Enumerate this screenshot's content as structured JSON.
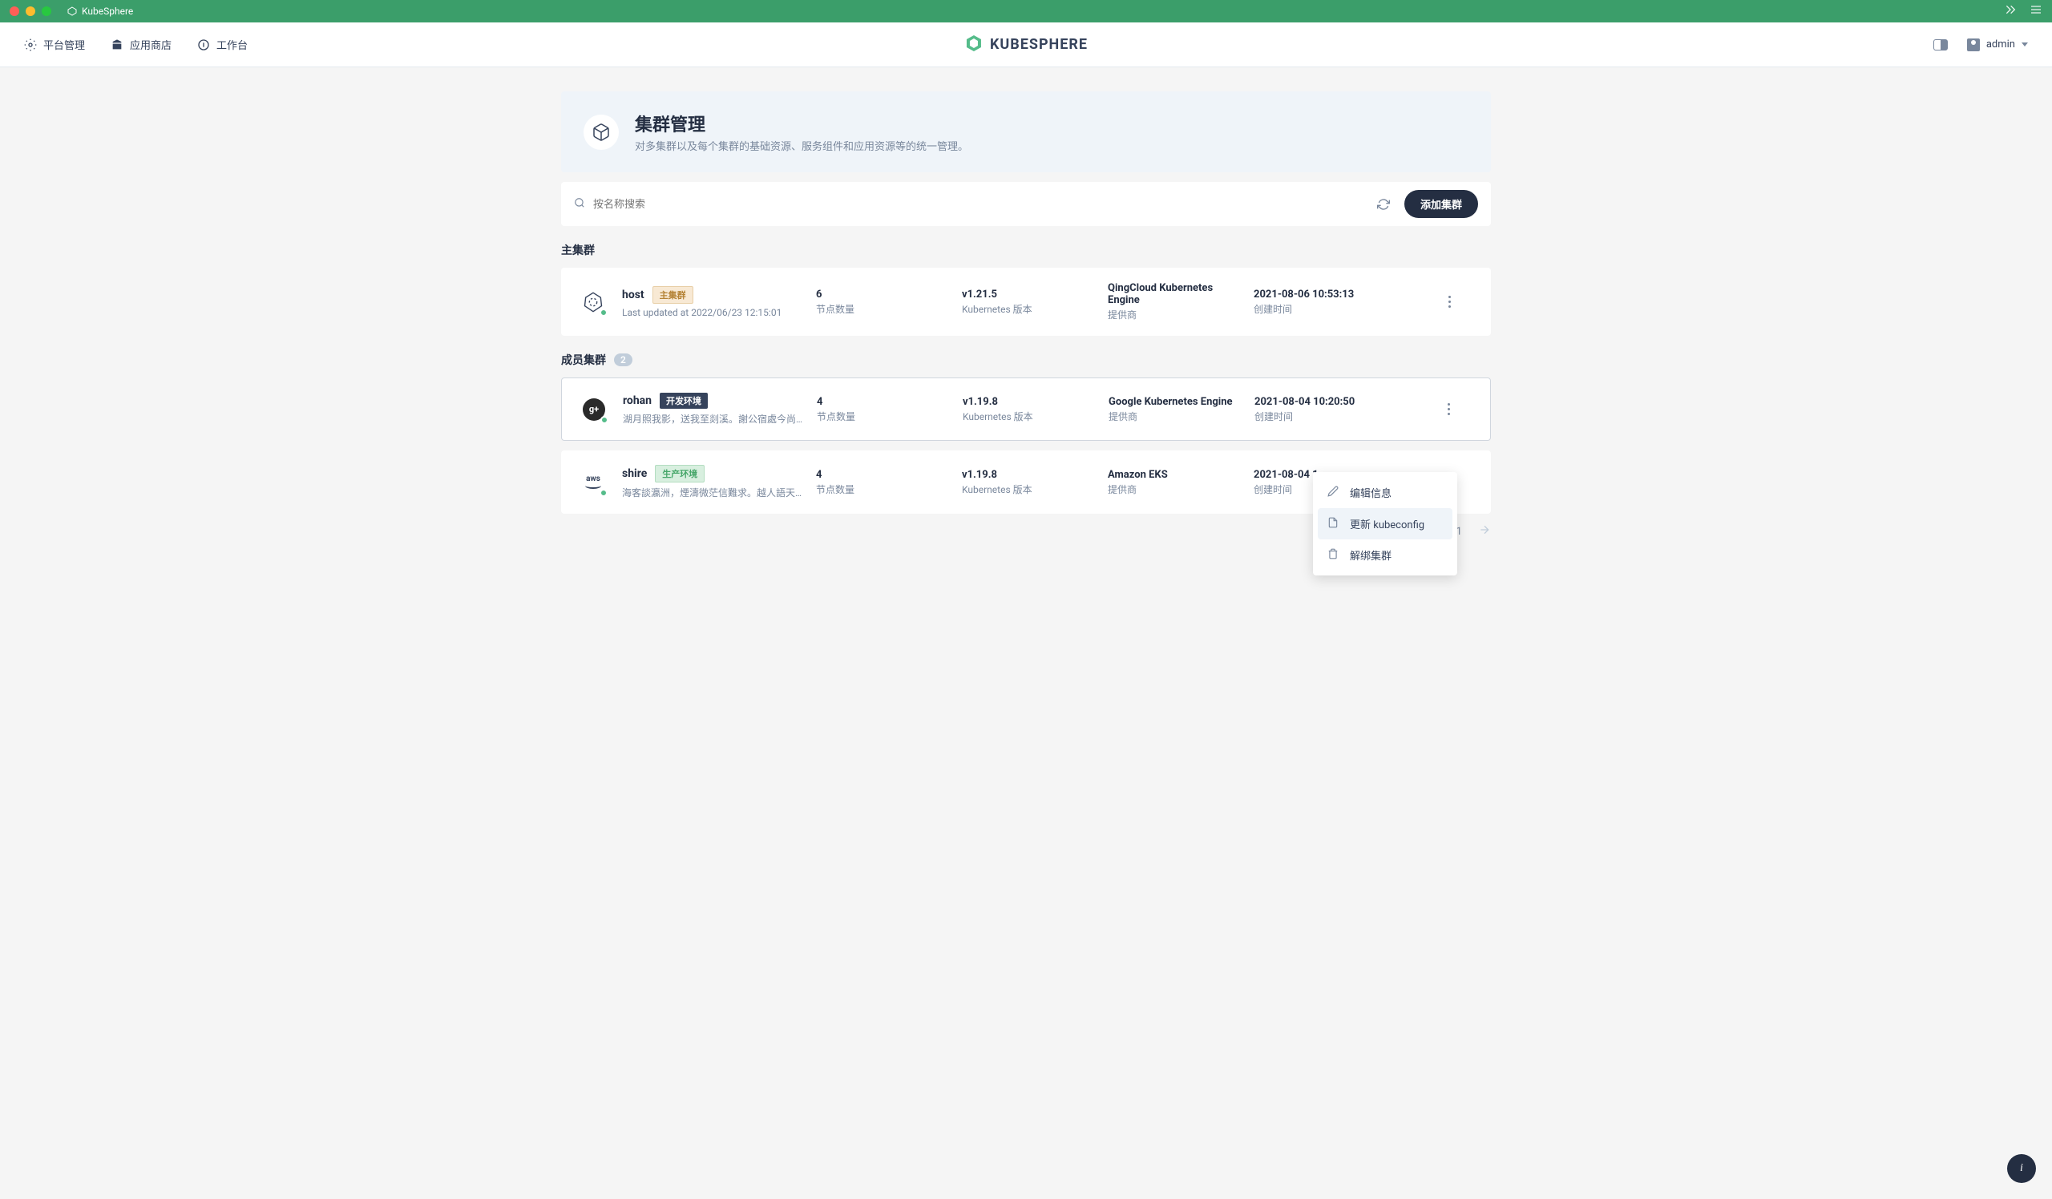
{
  "window": {
    "title": "KubeSphere"
  },
  "nav": {
    "platform": "平台管理",
    "appstore": "应用商店",
    "workbench": "工作台",
    "brand": "KUBESPHERE",
    "user": "admin"
  },
  "header": {
    "title": "集群管理",
    "desc": "对多集群以及每个集群的基础资源、服务组件和应用资源等的统一管理。"
  },
  "toolbar": {
    "search_placeholder": "按名称搜索",
    "add_label": "添加集群"
  },
  "sections": {
    "host_title": "主集群",
    "member_title": "成员集群",
    "member_count": "2"
  },
  "labels": {
    "nodes": "节点数量",
    "k8s_version": "Kubernetes 版本",
    "provider": "提供商",
    "created": "创建时间"
  },
  "host_cluster": {
    "name": "host",
    "tag": "主集群",
    "meta": "Last updated at 2022/06/23 12:15:01",
    "nodes": "6",
    "version": "v1.21.5",
    "provider": "QingCloud Kubernetes Engine",
    "created": "2021-08-06 10:53:13"
  },
  "members": [
    {
      "name": "rohan",
      "tag": "开发环境",
      "tag_class": "tag-dev",
      "meta": "湖月照我影，送我至剡溪。謝公宿處今尚在，...",
      "nodes": "4",
      "version": "v1.19.8",
      "provider": "Google Kubernetes Engine",
      "created": "2021-08-04 10:20:50",
      "icon": "gplus"
    },
    {
      "name": "shire",
      "tag": "生产环境",
      "tag_class": "tag-prod",
      "meta": "海客談瀛洲，煙濤微茫信難求。越人語天姥，...",
      "nodes": "4",
      "version": "v1.19.8",
      "provider": "Amazon EKS",
      "created": "2021-08-04 1",
      "icon": "aws"
    }
  ],
  "dropdown": {
    "edit": "编辑信息",
    "update": "更新 kubeconfig",
    "unbind": "解绑集群"
  },
  "pagination": {
    "text": "1 / 1"
  }
}
